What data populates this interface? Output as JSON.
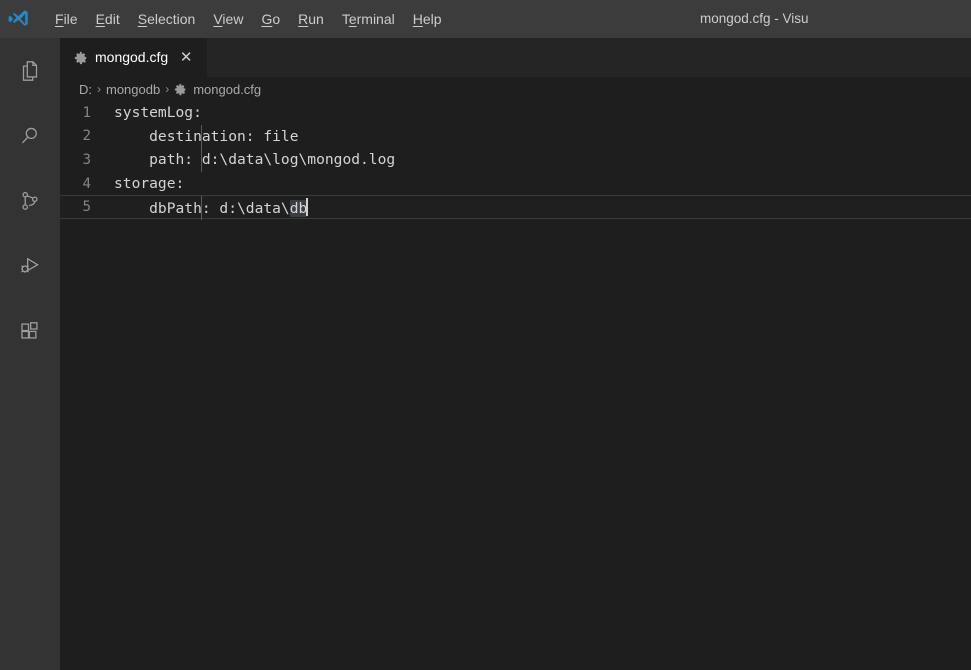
{
  "window": {
    "title": "mongod.cfg - Visu",
    "logo_icon": "vscode-logo-icon"
  },
  "menubar": {
    "items": [
      {
        "label": "File",
        "accesskey": "F"
      },
      {
        "label": "Edit",
        "accesskey": "E"
      },
      {
        "label": "Selection",
        "accesskey": "S"
      },
      {
        "label": "View",
        "accesskey": "V"
      },
      {
        "label": "Go",
        "accesskey": "G"
      },
      {
        "label": "Run",
        "accesskey": "R"
      },
      {
        "label": "Terminal",
        "accesskey": "T"
      },
      {
        "label": "Help",
        "accesskey": "H"
      }
    ]
  },
  "activitybar": {
    "items": [
      {
        "name": "explorer",
        "icon": "files-icon"
      },
      {
        "name": "search",
        "icon": "search-icon"
      },
      {
        "name": "source-control",
        "icon": "source-control-branch-icon"
      },
      {
        "name": "run-and-debug",
        "icon": "run-debug-icon"
      },
      {
        "name": "extensions",
        "icon": "extensions-icon"
      }
    ]
  },
  "tabs": [
    {
      "label": "mongod.cfg",
      "icon": "gear-icon",
      "close_label": "✕",
      "active": true
    }
  ],
  "breadcrumb": {
    "separator": "›",
    "items": [
      {
        "label": "D:",
        "icon": ""
      },
      {
        "label": "mongodb",
        "icon": ""
      },
      {
        "label": "mongod.cfg",
        "icon": "gear-icon"
      }
    ]
  },
  "editor": {
    "language": "plaintext",
    "cursor_line": 5,
    "selected_word": "db",
    "lines": [
      {
        "number": "1",
        "text": "systemLog:",
        "indent_guide": false
      },
      {
        "number": "2",
        "text": "    destination: file",
        "indent_guide": true
      },
      {
        "number": "3",
        "text": "    path: d:\\data\\log\\mongod.log",
        "indent_guide": true
      },
      {
        "number": "4",
        "text": "storage:",
        "indent_guide": false
      },
      {
        "number": "5",
        "text": "    dbPath: d:\\data\\",
        "indent_guide": true,
        "highlight_tail": "db",
        "current": true
      }
    ]
  },
  "colors": {
    "titlebar_bg": "#3c3c3c",
    "activitybar_bg": "#333333",
    "editor_bg": "#1e1e1e",
    "tabbar_bg": "#252526",
    "text": "#d4d4d4",
    "linenumber": "#858585",
    "accent": "#0e639c",
    "logo_blue": "#2489ca"
  }
}
